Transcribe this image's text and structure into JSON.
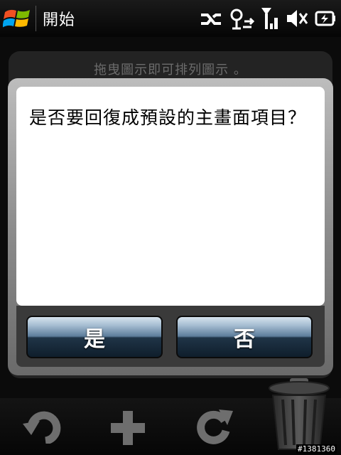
{
  "statusbar": {
    "title": "開始",
    "icons": [
      "windows-logo-icon",
      "sync-icon",
      "connectivity-icon",
      "signal-icon",
      "volume-muted-icon",
      "battery-charging-icon"
    ]
  },
  "background": {
    "hint": "拖曳圖示即可排列圖示 。"
  },
  "dialog": {
    "message": "是否要回復成預設的主畫面項目？",
    "yes_label": "是",
    "no_label": "否"
  },
  "toolbar": {
    "icons": [
      "undo-icon",
      "add-icon",
      "refresh-icon",
      "trash-icon"
    ]
  },
  "watermark": "#1381360",
  "colors": {
    "accent_button": "#1f3447",
    "dialog_frame": "#8d8d8d",
    "background": "#0b0b0b"
  }
}
